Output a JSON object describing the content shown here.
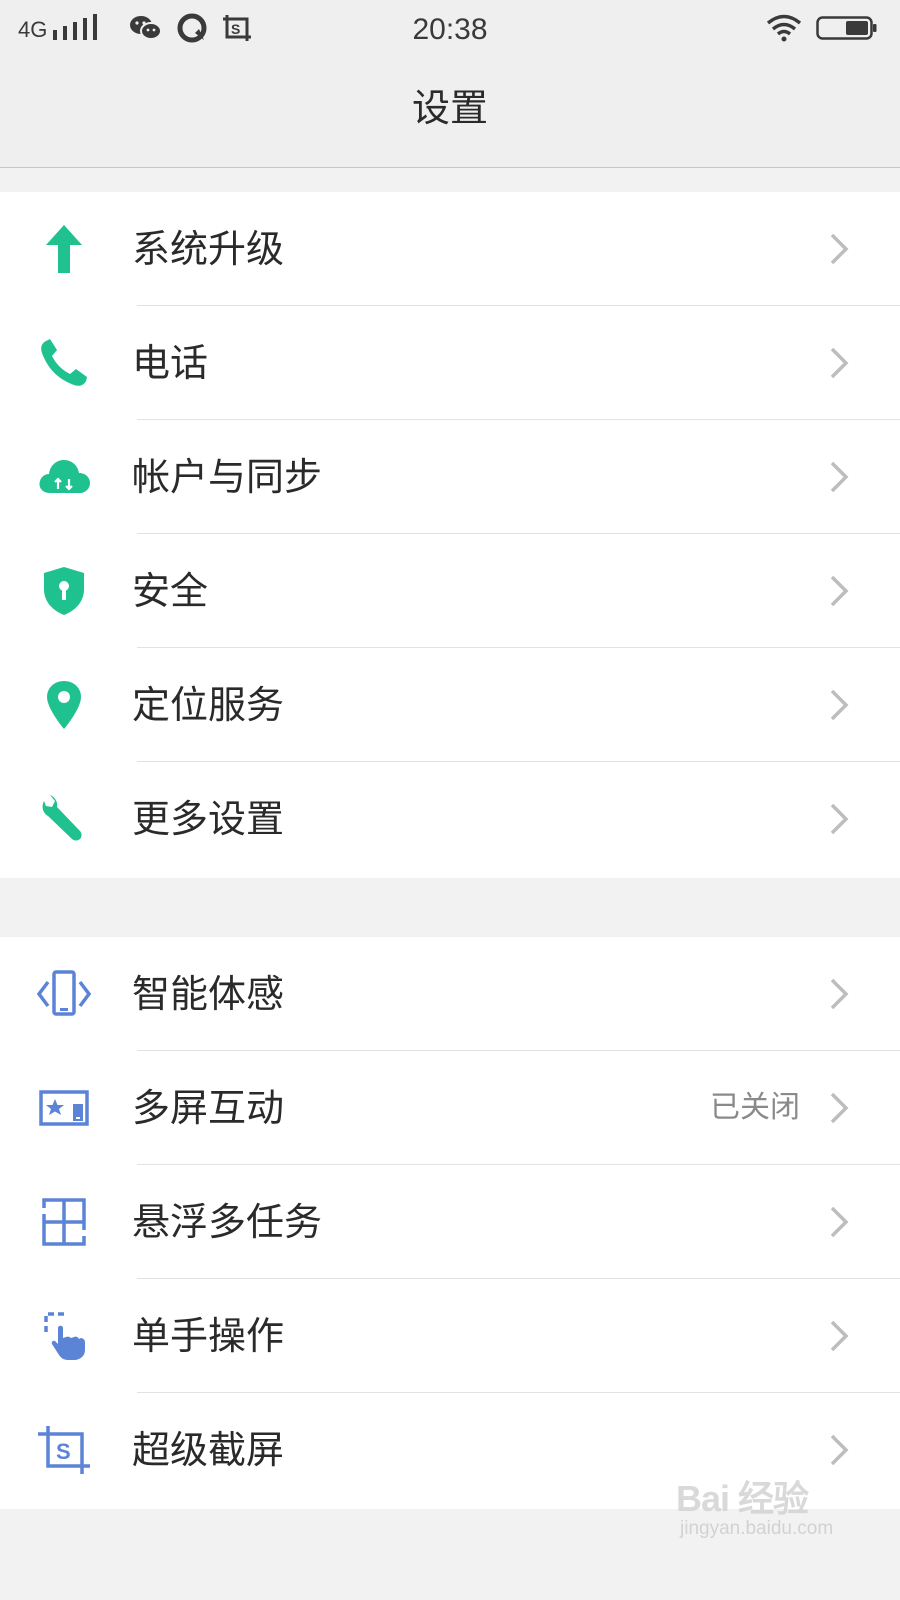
{
  "status_bar": {
    "network": "4G",
    "time": "20:38",
    "icons": [
      "signal-icon",
      "wechat-icon",
      "messenger-icon",
      "screenshot-icon",
      "wifi-icon",
      "battery-icon"
    ]
  },
  "header": {
    "title": "设置"
  },
  "colors": {
    "accent_green": "#1fc28f",
    "accent_blue": "#5b84d6",
    "chevron": "#bdbdbd"
  },
  "groups": [
    {
      "items": [
        {
          "label": "系统升级",
          "icon": "upgrade-arrow-icon"
        },
        {
          "label": "电话",
          "icon": "phone-icon"
        },
        {
          "label": "帐户与同步",
          "icon": "cloud-sync-icon"
        },
        {
          "label": "安全",
          "icon": "shield-lock-icon"
        },
        {
          "label": "定位服务",
          "icon": "location-pin-icon"
        },
        {
          "label": "更多设置",
          "icon": "wrench-icon"
        }
      ]
    },
    {
      "items": [
        {
          "label": "智能体感",
          "icon": "motion-sense-icon"
        },
        {
          "label": "多屏互动",
          "icon": "multi-screen-icon",
          "value": "已关闭"
        },
        {
          "label": "悬浮多任务",
          "icon": "floating-multitask-icon"
        },
        {
          "label": "单手操作",
          "icon": "one-hand-icon"
        },
        {
          "label": "超级截屏",
          "icon": "super-screenshot-icon"
        }
      ]
    }
  ],
  "watermark": {
    "logo": "Bai 经验",
    "url": "jingyan.baidu.com"
  }
}
